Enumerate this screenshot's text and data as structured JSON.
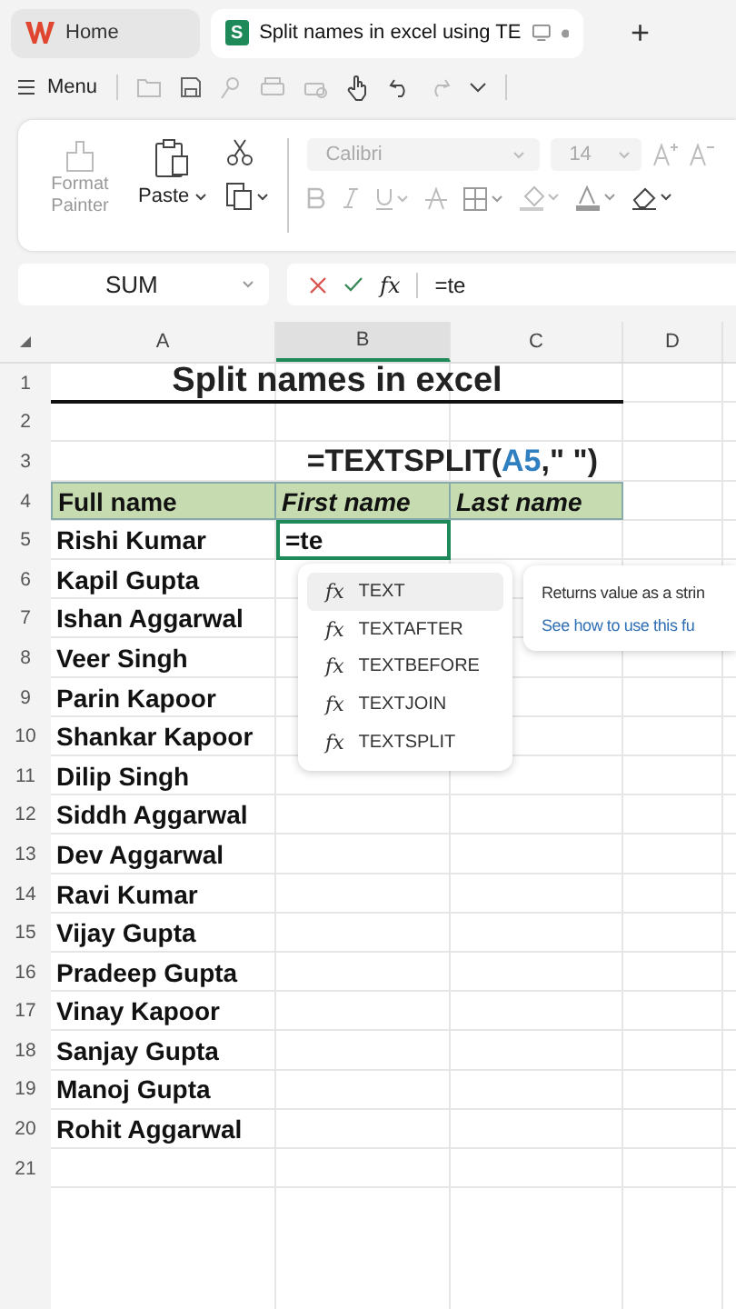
{
  "tabs": [
    {
      "label": "Home",
      "kind": "home",
      "selected": false
    },
    {
      "label": "Split names in excel using TE",
      "kind": "sheet",
      "selected": true,
      "logo": "S"
    }
  ],
  "new_tab": "+",
  "menu": {
    "label": "Menu"
  },
  "ribbon": {
    "format_painter": {
      "label": "Format Painter",
      "disabled": true
    },
    "paste": {
      "label": "Paste"
    },
    "font": "Calibri",
    "size": "14"
  },
  "formula_bar": {
    "name_box": "SUM",
    "function_label": "fx",
    "value": "=te"
  },
  "columns": [
    {
      "label": "A",
      "selected": false
    },
    {
      "label": "B",
      "selected": true
    },
    {
      "label": "C",
      "selected": false
    },
    {
      "label": "D",
      "selected": false
    }
  ],
  "rows": [
    {
      "number": "1",
      "kind": "title",
      "text": "Split names in excel"
    },
    {
      "number": "2",
      "kind": "empty"
    },
    {
      "number": "3",
      "kind": "hint",
      "before": "=TEXTSPLIT(",
      "ref": "A5",
      "after": ",\" \")"
    },
    {
      "number": "4",
      "kind": "header",
      "cells": [
        {
          "text": "Full name",
          "italic": false
        },
        {
          "text": "First name",
          "italic": true
        },
        {
          "text": "Last name",
          "italic": true
        }
      ]
    },
    {
      "number": "5",
      "kind": "data",
      "cells": [
        {
          "text": "Rishi Kumar",
          "selected": false
        },
        {
          "text": "=te",
          "selected": true
        }
      ]
    },
    {
      "number": "6",
      "kind": "data",
      "cells": [
        {
          "text": "Kapil Gupta",
          "selected": false
        }
      ]
    },
    {
      "number": "7",
      "kind": "data",
      "cells": [
        {
          "text": "Ishan Aggarwal",
          "selected": false
        }
      ]
    },
    {
      "number": "8",
      "kind": "data",
      "cells": [
        {
          "text": "Veer Singh",
          "selected": false
        }
      ]
    },
    {
      "number": "9",
      "kind": "data",
      "cells": [
        {
          "text": "Parin Kapoor",
          "selected": false
        }
      ]
    },
    {
      "number": "10",
      "kind": "data",
      "cells": [
        {
          "text": "Shankar Kapoor",
          "selected": false
        }
      ]
    },
    {
      "number": "11",
      "kind": "data",
      "cells": [
        {
          "text": "Dilip Singh",
          "selected": false
        }
      ]
    },
    {
      "number": "12",
      "kind": "data",
      "cells": [
        {
          "text": "Siddh Aggarwal",
          "selected": false
        }
      ]
    },
    {
      "number": "13",
      "kind": "data",
      "cells": [
        {
          "text": "Dev Aggarwal",
          "selected": false
        }
      ]
    },
    {
      "number": "14",
      "kind": "data",
      "cells": [
        {
          "text": "Ravi Kumar",
          "selected": false
        }
      ]
    },
    {
      "number": "15",
      "kind": "data",
      "cells": [
        {
          "text": "Vijay Gupta",
          "selected": false
        }
      ]
    },
    {
      "number": "16",
      "kind": "data",
      "cells": [
        {
          "text": "Pradeep Gupta",
          "selected": false
        }
      ]
    },
    {
      "number": "17",
      "kind": "data",
      "cells": [
        {
          "text": "Vinay Kapoor",
          "selected": false
        }
      ]
    },
    {
      "number": "18",
      "kind": "data",
      "cells": [
        {
          "text": "Sanjay Gupta",
          "selected": false
        }
      ]
    },
    {
      "number": "19",
      "kind": "data",
      "cells": [
        {
          "text": "Manoj Gupta",
          "selected": false
        }
      ]
    },
    {
      "number": "20",
      "kind": "data",
      "cells": [
        {
          "text": "Rohit Aggarwal",
          "selected": false
        }
      ]
    },
    {
      "number": "21",
      "kind": "empty"
    }
  ],
  "autocomplete": [
    {
      "symbol": "fx",
      "name": "TEXT",
      "selected": true
    },
    {
      "symbol": "fx",
      "name": "TEXTAFTER",
      "selected": false
    },
    {
      "symbol": "fx",
      "name": "TEXTBEFORE",
      "selected": false
    },
    {
      "symbol": "fx",
      "name": "TEXTJOIN",
      "selected": false
    },
    {
      "symbol": "fx",
      "name": "TEXTSPLIT",
      "selected": false
    }
  ],
  "tooltip": {
    "description": "Returns value as a strin",
    "link": "See how to use this fu"
  }
}
